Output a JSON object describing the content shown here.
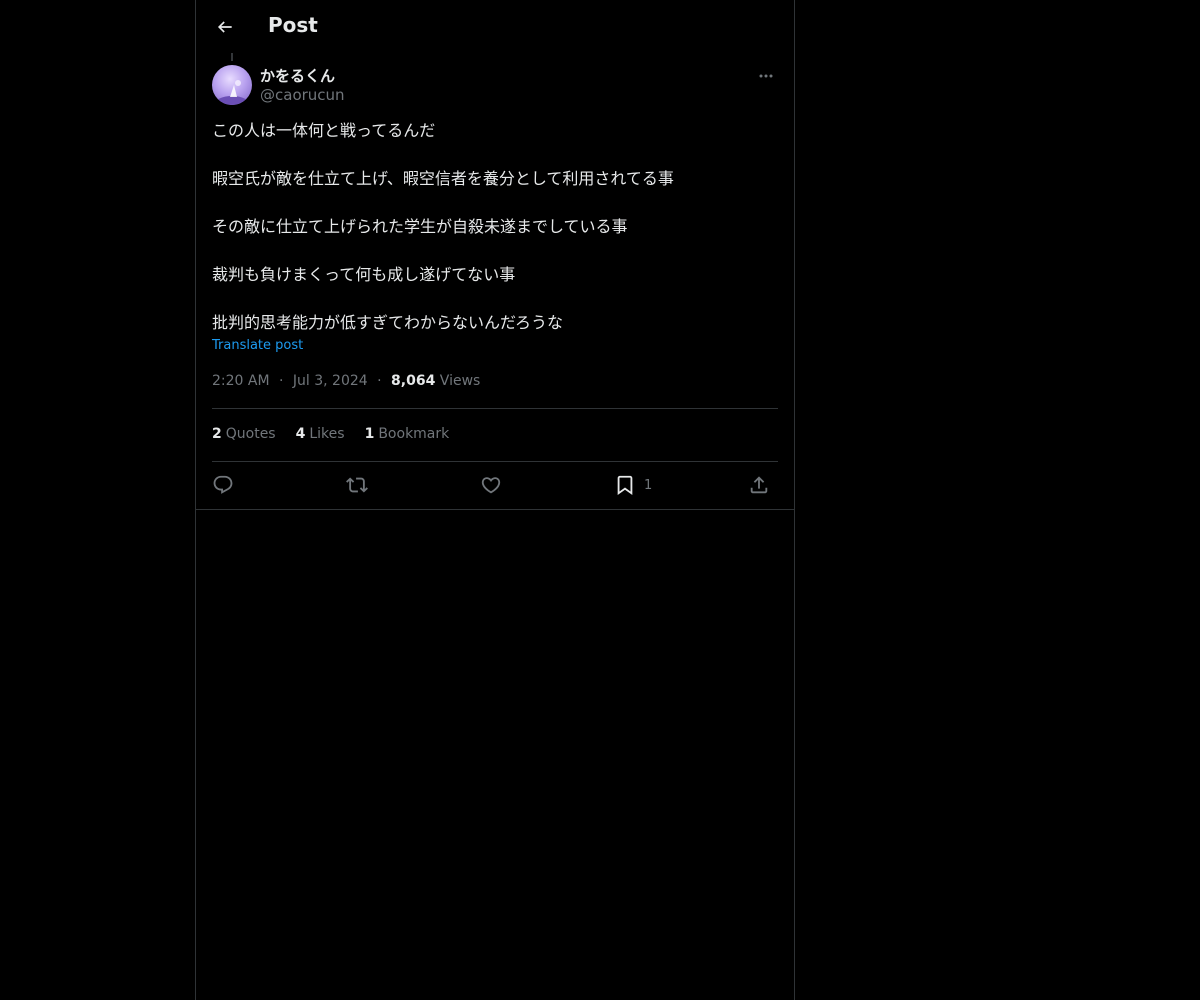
{
  "header": {
    "title": "Post"
  },
  "author": {
    "name": "かをるくん",
    "handle": "@caorucun"
  },
  "post": {
    "paragraphs": [
      "この人は一体何と戦ってるんだ",
      "暇空氏が敵を仕立て上げ、暇空信者を養分として利用されてる事",
      "その敵に仕立て上げられた学生が自殺未遂までしている事",
      "裁判も負けまくって何も成し遂げてない事",
      "批判的思考能力が低すぎてわからないんだろうな"
    ],
    "translate_label": "Translate post",
    "time": "2:20 AM",
    "date": "Jul 3, 2024",
    "separator": "·",
    "views_count": "8,064",
    "views_label": "Views"
  },
  "stats": {
    "quotes": {
      "count": "2",
      "label": "Quotes"
    },
    "likes": {
      "count": "4",
      "label": "Likes"
    },
    "bookmarks": {
      "count": "1",
      "label": "Bookmark"
    }
  },
  "actions": {
    "bookmark_count": "1"
  },
  "icons": {
    "back": "arrow-left-icon",
    "more": "more-horizontal-icon",
    "reply": "reply-icon",
    "repost": "repost-icon",
    "like": "heart-icon",
    "bookmark": "bookmark-icon",
    "share": "share-icon"
  },
  "colors": {
    "background": "#000000",
    "text": "#e7e9ea",
    "muted": "#71767b",
    "link": "#1d9bf0",
    "border": "#2f3336"
  }
}
